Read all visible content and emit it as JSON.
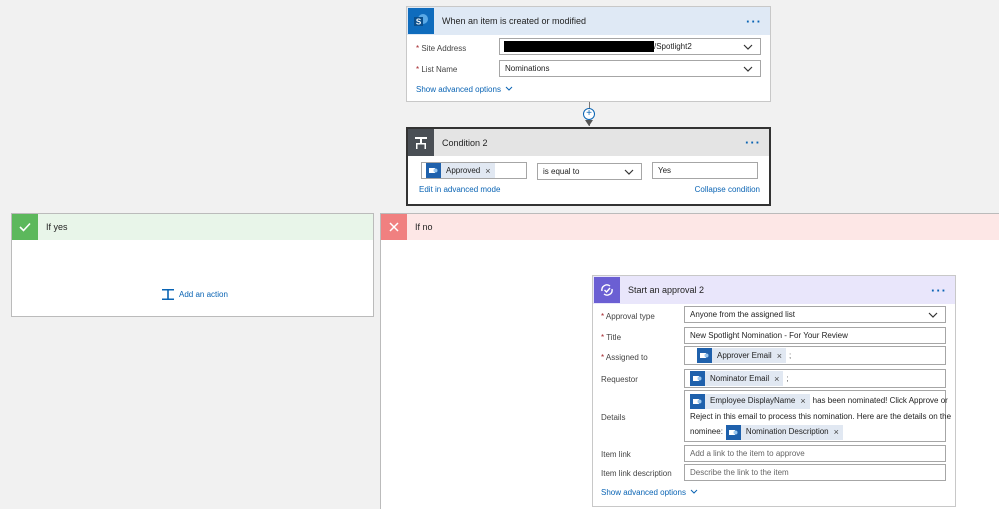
{
  "trigger": {
    "title": "When an item is created or modified",
    "site_address_label": "Site Address",
    "site_address_value": "/Spotlight2",
    "list_name_label": "List Name",
    "list_name_value": "Nominations",
    "advanced_link": "Show advanced options"
  },
  "condition": {
    "title": "Condition 2",
    "token_label": "Approved",
    "operator": "is equal to",
    "value": "Yes",
    "edit_advanced_link": "Edit in advanced mode",
    "collapse_link": "Collapse condition"
  },
  "if_yes": {
    "title": "If yes",
    "add_action": "Add an action"
  },
  "if_no": {
    "title": "If no"
  },
  "approval": {
    "title": "Start an approval 2",
    "approval_type_label": "Approval type",
    "approval_type_value": "Anyone from the assigned list",
    "title_label": "Title",
    "title_value": "New Spotlight Nomination - For Your Review",
    "assigned_label": "Assigned to",
    "assigned_token": "Approver Email",
    "requestor_label": "Requestor",
    "requestor_token": "Nominator Email",
    "details_label": "Details",
    "details_token1": "Employee DisplayName",
    "details_text1": "has been nominated!  Click Approve or",
    "details_text2": "Reject in this email to process this nomination.  Here are the details on the",
    "details_text3": "nominee:",
    "details_token2": "Nomination Description",
    "item_link_label": "Item link",
    "item_link_placeholder": "Add a link to the item to approve",
    "item_link_desc_label": "Item link description",
    "item_link_desc_placeholder": "Describe the link to the item",
    "advanced_link": "Show advanced options",
    "semicolon": ";"
  },
  "colors": {
    "sharepoint": "#0f6cbd",
    "condition_header": "#4a4f55",
    "yes_header": "#e8f5e9",
    "yes_icon": "#5cb85c",
    "no_header": "#fde7e6",
    "no_icon": "#f08080",
    "approval_header": "#e9e6fb",
    "approval_icon": "#6b5fd3",
    "link": "#0a64b4"
  }
}
